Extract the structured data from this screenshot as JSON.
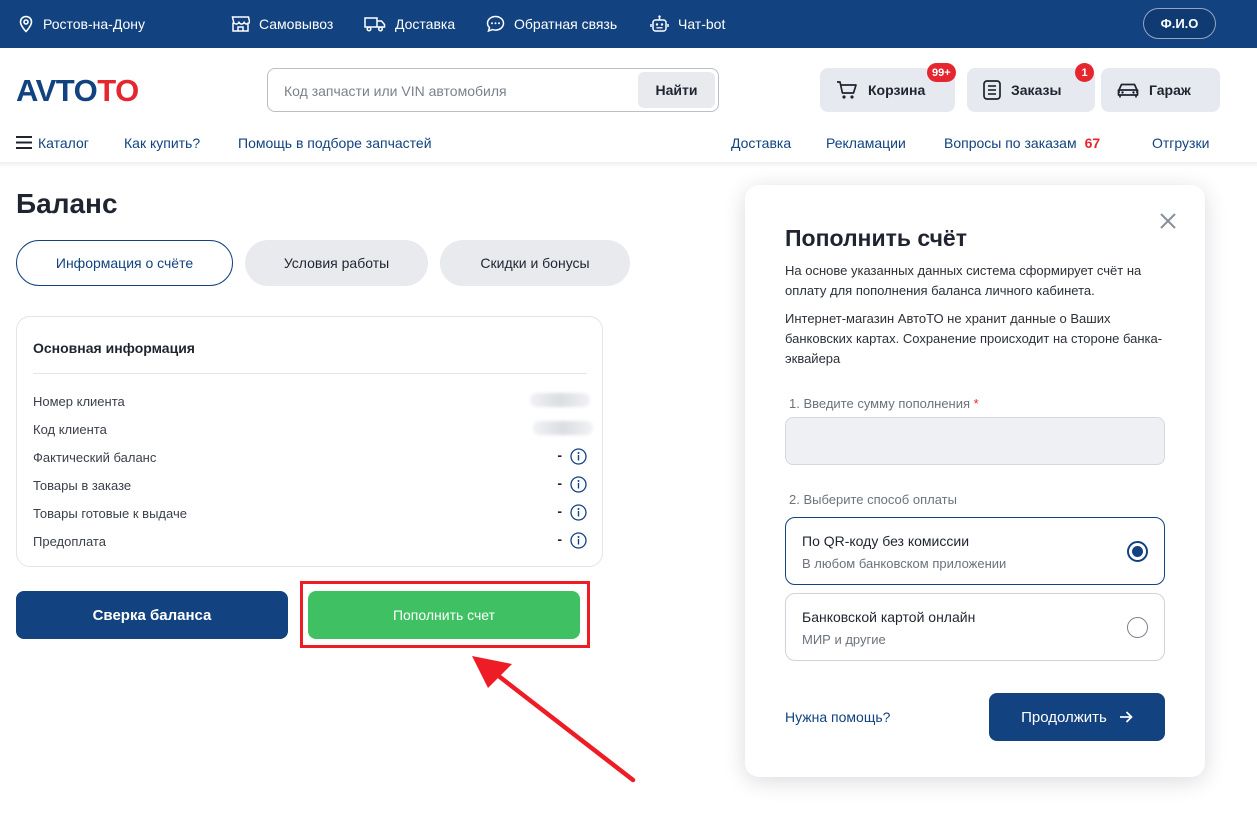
{
  "topbar": {
    "city": "Ростов-на-Дону",
    "pickup": "Самовывоз",
    "delivery": "Доставка",
    "feedback": "Обратная связь",
    "chatbot": "Чат-bot",
    "user_button": "Ф.И.О"
  },
  "header": {
    "logo": "AVTOTO",
    "search": {
      "placeholder": "Код запчасти или VIN автомобиля",
      "value": "",
      "button": "Найти"
    },
    "cart": {
      "label": "Корзина",
      "badge": "99+"
    },
    "orders": {
      "label": "Заказы",
      "badge": "1"
    },
    "garage": {
      "label": "Гараж"
    }
  },
  "nav": {
    "catalog": "Каталог",
    "how_to_buy": "Как купить?",
    "parts_help": "Помощь в подборе запчастей",
    "delivery": "Доставка",
    "claims": "Рекламации",
    "order_questions": "Вопросы по заказам",
    "order_questions_count": "67",
    "shipments": "Отгрузки"
  },
  "balance": {
    "title": "Баланс",
    "tabs": [
      "Информация о счёте",
      "Условия работы",
      "Скидки и бонусы"
    ],
    "card_title": "Основная информация",
    "rows": [
      {
        "label": "Номер клиента",
        "value": ""
      },
      {
        "label": "Код клиента",
        "value": ""
      },
      {
        "label": "Фактический баланс",
        "value": "-"
      },
      {
        "label": "Товары в заказе",
        "value": "-"
      },
      {
        "label": "Товары готовые к выдаче",
        "value": "-"
      },
      {
        "label": "Предоплата",
        "value": "-"
      }
    ],
    "reconcile_button": "Сверка баланса",
    "topup_button": "Пополнить счет"
  },
  "modal": {
    "title": "Пополнить счёт",
    "text1": "На основе указанных данных система сформирует счёт на оплату для пополнения баланса личного кабинета.",
    "text2": "Интернет-магазин АвтоТО не хранит данные о Ваших банковских картах. Сохранение происходит на стороне банка-эквайера",
    "amount_label": "1. Введите сумму пополнения",
    "amount_required": "*",
    "amount_value": "",
    "method_label": "2. Выберите способ оплаты",
    "options": [
      {
        "title": "По QR-коду без комиссии",
        "subtitle": "В любом банковском приложении",
        "selected": true
      },
      {
        "title": "Банковской картой онлайн",
        "subtitle": "МИР и другие",
        "selected": false
      }
    ],
    "help_link": "Нужна помощь?",
    "continue_button": "Продолжить"
  },
  "colors": {
    "brand_blue": "#12427f",
    "accent_red": "#e5262f",
    "topup_green": "#3fc163",
    "highlight_red": "#ee1c24"
  }
}
